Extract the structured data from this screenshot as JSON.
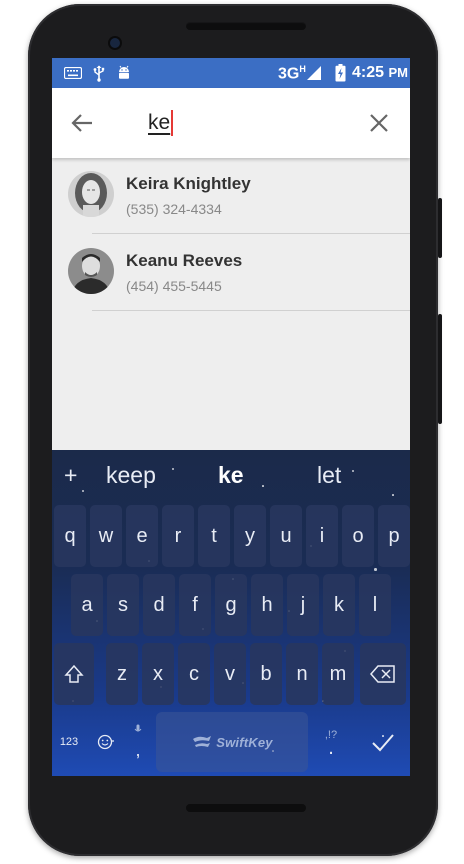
{
  "status_bar": {
    "network": "3G",
    "network_sup": "H",
    "time": "4:25",
    "time_suffix": "PM",
    "left_icons": [
      "keyboard-icon",
      "usb-icon",
      "android-debug-icon"
    ],
    "right_icons": [
      "signal-icon",
      "battery-charging-icon"
    ]
  },
  "search": {
    "query": "ke",
    "back_icon": "arrow-left-icon",
    "clear_icon": "close-icon"
  },
  "contacts": [
    {
      "name": "Keira Knightley",
      "phone": "(535) 324-4334"
    },
    {
      "name": "Keanu Reeves",
      "phone": "(454) 455-5445"
    }
  ],
  "keyboard": {
    "predictions": [
      "keep",
      "ke",
      "let"
    ],
    "plus": "+",
    "row1": [
      "q",
      "w",
      "e",
      "r",
      "t",
      "y",
      "u",
      "i",
      "o",
      "p"
    ],
    "row2": [
      "a",
      "s",
      "d",
      "f",
      "g",
      "h",
      "j",
      "k",
      "l"
    ],
    "row3": [
      "z",
      "x",
      "c",
      "v",
      "b",
      "n",
      "m"
    ],
    "numbers_label": "123",
    "comma": ",",
    "punct_label": ",!?",
    "period": ".",
    "space_label": "SwiftKey",
    "colors": {
      "accent": "#3b6ec4",
      "kb_top": "#1b2a4a",
      "kb_bottom": "#1f4bb4"
    }
  }
}
